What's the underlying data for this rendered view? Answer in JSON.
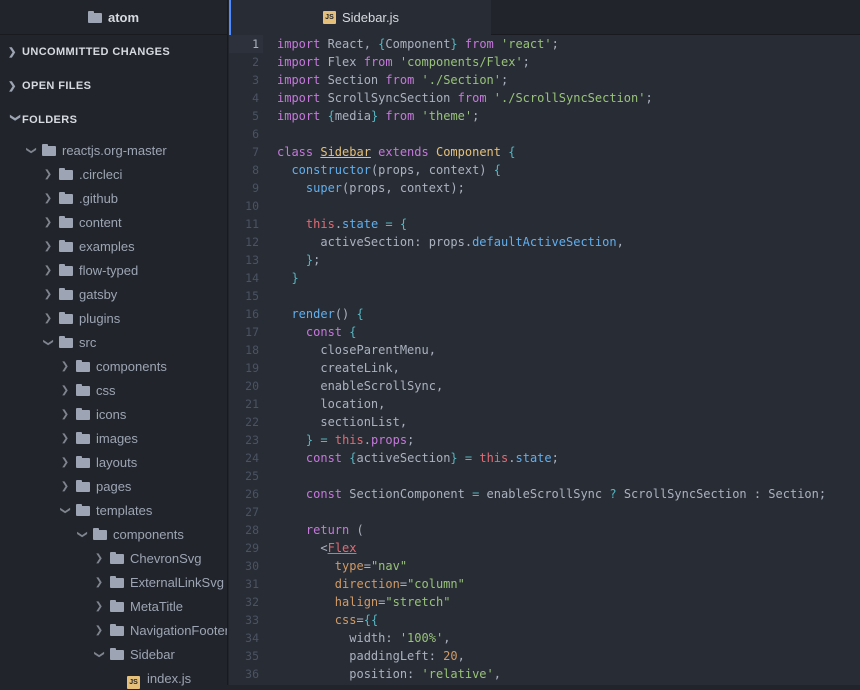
{
  "app": {
    "project_name": "atom",
    "active_tab": "Sidebar.js"
  },
  "sections": {
    "uncommitted": "UNCOMMITTED CHANGES",
    "open_files": "OPEN FILES",
    "folders": "FOLDERS"
  },
  "tree": [
    {
      "label": "reactjs.org-master",
      "depth": 0,
      "type": "folder",
      "expanded": true
    },
    {
      "label": ".circleci",
      "depth": 1,
      "type": "folder",
      "expanded": false
    },
    {
      "label": ".github",
      "depth": 1,
      "type": "folder",
      "expanded": false
    },
    {
      "label": "content",
      "depth": 1,
      "type": "folder",
      "expanded": false
    },
    {
      "label": "examples",
      "depth": 1,
      "type": "folder",
      "expanded": false
    },
    {
      "label": "flow-typed",
      "depth": 1,
      "type": "folder",
      "expanded": false
    },
    {
      "label": "gatsby",
      "depth": 1,
      "type": "folder",
      "expanded": false
    },
    {
      "label": "plugins",
      "depth": 1,
      "type": "folder",
      "expanded": false
    },
    {
      "label": "src",
      "depth": 1,
      "type": "folder",
      "expanded": true
    },
    {
      "label": "components",
      "depth": 2,
      "type": "folder",
      "expanded": false
    },
    {
      "label": "css",
      "depth": 2,
      "type": "folder",
      "expanded": false
    },
    {
      "label": "icons",
      "depth": 2,
      "type": "folder",
      "expanded": false
    },
    {
      "label": "images",
      "depth": 2,
      "type": "folder",
      "expanded": false
    },
    {
      "label": "layouts",
      "depth": 2,
      "type": "folder",
      "expanded": false
    },
    {
      "label": "pages",
      "depth": 2,
      "type": "folder",
      "expanded": false
    },
    {
      "label": "templates",
      "depth": 2,
      "type": "folder",
      "expanded": true
    },
    {
      "label": "components",
      "depth": 3,
      "type": "folder",
      "expanded": true
    },
    {
      "label": "ChevronSvg",
      "depth": 4,
      "type": "folder",
      "expanded": false
    },
    {
      "label": "ExternalLinkSvg",
      "depth": 4,
      "type": "folder",
      "expanded": false
    },
    {
      "label": "MetaTitle",
      "depth": 4,
      "type": "folder",
      "expanded": false
    },
    {
      "label": "NavigationFooter",
      "depth": 4,
      "type": "folder",
      "expanded": false
    },
    {
      "label": "Sidebar",
      "depth": 4,
      "type": "folder",
      "expanded": true
    },
    {
      "label": "index.js",
      "depth": 5,
      "type": "js"
    }
  ],
  "current_line": 1,
  "code_lines": [
    [
      [
        "kw",
        "import"
      ],
      [
        "pl",
        " React, "
      ],
      [
        "op",
        "{"
      ],
      [
        "pl",
        "Component"
      ],
      [
        "op",
        "}"
      ],
      [
        "kw",
        " from "
      ],
      [
        "str",
        "'react'"
      ],
      [
        "pl",
        ";"
      ]
    ],
    [
      [
        "kw",
        "import"
      ],
      [
        "pl",
        " Flex "
      ],
      [
        "kw",
        "from "
      ],
      [
        "str",
        "'components/Flex'"
      ],
      [
        "pl",
        ";"
      ]
    ],
    [
      [
        "kw",
        "import"
      ],
      [
        "pl",
        " Section "
      ],
      [
        "kw",
        "from "
      ],
      [
        "str",
        "'./Section'"
      ],
      [
        "pl",
        ";"
      ]
    ],
    [
      [
        "kw",
        "import"
      ],
      [
        "pl",
        " ScrollSyncSection "
      ],
      [
        "kw",
        "from "
      ],
      [
        "str",
        "'./ScrollSyncSection'"
      ],
      [
        "pl",
        ";"
      ]
    ],
    [
      [
        "kw",
        "import"
      ],
      [
        "pl",
        " "
      ],
      [
        "op",
        "{"
      ],
      [
        "pl",
        "media"
      ],
      [
        "op",
        "}"
      ],
      [
        "kw",
        " from "
      ],
      [
        "str",
        "'theme'"
      ],
      [
        "pl",
        ";"
      ]
    ],
    [],
    [
      [
        "kw",
        "class "
      ],
      [
        "cls ul",
        "Sidebar"
      ],
      [
        "kw",
        " extends "
      ],
      [
        "cls",
        "Component"
      ],
      [
        "pl",
        " "
      ],
      [
        "op",
        "{"
      ]
    ],
    [
      [
        "pl",
        "  "
      ],
      [
        "fn",
        "constructor"
      ],
      [
        "pl",
        "(props, context) "
      ],
      [
        "op",
        "{"
      ]
    ],
    [
      [
        "pl",
        "    "
      ],
      [
        "fn",
        "super"
      ],
      [
        "pl",
        "(props, context);"
      ]
    ],
    [],
    [
      [
        "pl",
        "    "
      ],
      [
        "this",
        "this"
      ],
      [
        "pl",
        "."
      ],
      [
        "fn",
        "state"
      ],
      [
        "pl",
        " "
      ],
      [
        "op",
        "="
      ],
      [
        "pl",
        " "
      ],
      [
        "op",
        "{"
      ]
    ],
    [
      [
        "pl",
        "      activeSection: props."
      ],
      [
        "fn",
        "defaultActiveSection"
      ],
      [
        "pl",
        ","
      ]
    ],
    [
      [
        "pl",
        "    "
      ],
      [
        "op",
        "}"
      ],
      [
        "pl",
        ";"
      ]
    ],
    [
      [
        "pl",
        "  "
      ],
      [
        "op",
        "}"
      ]
    ],
    [],
    [
      [
        "pl",
        "  "
      ],
      [
        "fn",
        "render"
      ],
      [
        "pl",
        "() "
      ],
      [
        "op",
        "{"
      ]
    ],
    [
      [
        "pl",
        "    "
      ],
      [
        "kw",
        "const"
      ],
      [
        "pl",
        " "
      ],
      [
        "op",
        "{"
      ]
    ],
    [
      [
        "pl",
        "      closeParentMenu,"
      ]
    ],
    [
      [
        "pl",
        "      createLink,"
      ]
    ],
    [
      [
        "pl",
        "      enableScrollSync,"
      ]
    ],
    [
      [
        "pl",
        "      location,"
      ]
    ],
    [
      [
        "pl",
        "      sectionList,"
      ]
    ],
    [
      [
        "pl",
        "    "
      ],
      [
        "op",
        "}"
      ],
      [
        "pl",
        " "
      ],
      [
        "op",
        "="
      ],
      [
        "pl",
        " "
      ],
      [
        "this",
        "this"
      ],
      [
        "pl",
        "."
      ],
      [
        "kw",
        "props"
      ],
      [
        "pl",
        ";"
      ]
    ],
    [
      [
        "pl",
        "    "
      ],
      [
        "kw",
        "const"
      ],
      [
        "pl",
        " "
      ],
      [
        "op",
        "{"
      ],
      [
        "pl",
        "activeSection"
      ],
      [
        "op",
        "}"
      ],
      [
        "pl",
        " "
      ],
      [
        "op",
        "="
      ],
      [
        "pl",
        " "
      ],
      [
        "this",
        "this"
      ],
      [
        "pl",
        "."
      ],
      [
        "fn",
        "state"
      ],
      [
        "pl",
        ";"
      ]
    ],
    [],
    [
      [
        "pl",
        "    "
      ],
      [
        "kw",
        "const"
      ],
      [
        "pl",
        " SectionComponent "
      ],
      [
        "op",
        "="
      ],
      [
        "pl",
        " enableScrollSync "
      ],
      [
        "op",
        "?"
      ],
      [
        "pl",
        " ScrollSyncSection : Section;"
      ]
    ],
    [],
    [
      [
        "pl",
        "    "
      ],
      [
        "kw",
        "return"
      ],
      [
        "pl",
        " ("
      ]
    ],
    [
      [
        "pl",
        "      "
      ],
      [
        "pl",
        "<"
      ],
      [
        "tag",
        "Flex"
      ]
    ],
    [
      [
        "pl",
        "        "
      ],
      [
        "attr",
        "type"
      ],
      [
        "pl",
        "="
      ],
      [
        "str",
        "\"nav\""
      ]
    ],
    [
      [
        "pl",
        "        "
      ],
      [
        "attr",
        "direction"
      ],
      [
        "pl",
        "="
      ],
      [
        "str",
        "\"column\""
      ]
    ],
    [
      [
        "pl",
        "        "
      ],
      [
        "attr",
        "halign"
      ],
      [
        "pl",
        "="
      ],
      [
        "str",
        "\"stretch\""
      ]
    ],
    [
      [
        "pl",
        "        "
      ],
      [
        "attr",
        "css"
      ],
      [
        "pl",
        "="
      ],
      [
        "op",
        "{{"
      ]
    ],
    [
      [
        "pl",
        "          width: "
      ],
      [
        "str",
        "'100%'"
      ],
      [
        "pl",
        ","
      ]
    ],
    [
      [
        "pl",
        "          paddingLeft: "
      ],
      [
        "num",
        "20"
      ],
      [
        "pl",
        ","
      ]
    ],
    [
      [
        "pl",
        "          position: "
      ],
      [
        "str",
        "'relative'"
      ],
      [
        "pl",
        ","
      ]
    ]
  ]
}
